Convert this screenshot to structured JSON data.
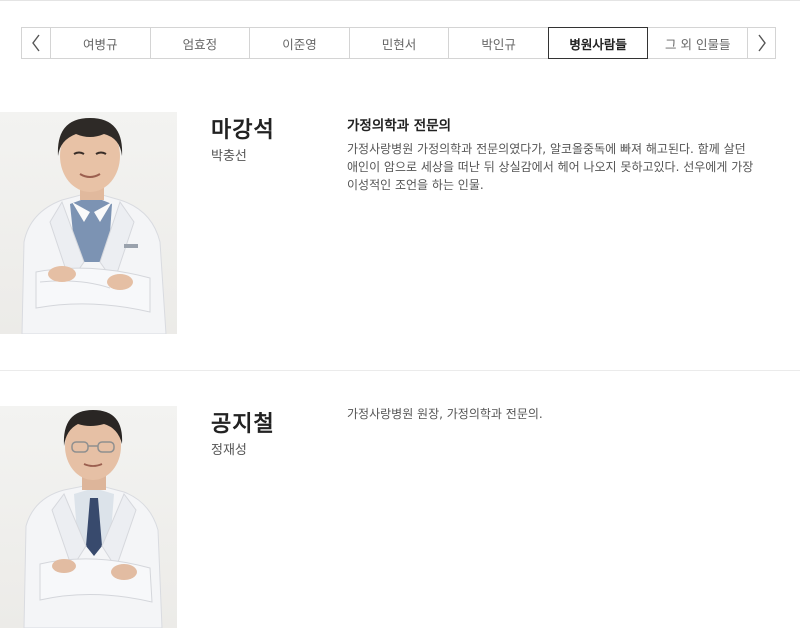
{
  "tabs": {
    "prev_icon": "chevron-left-icon",
    "next_icon": "chevron-right-icon",
    "items": [
      {
        "label": "여병규"
      },
      {
        "label": "엄효정"
      },
      {
        "label": "이준영"
      },
      {
        "label": "민현서"
      },
      {
        "label": "박인규"
      },
      {
        "label": "병원사람들"
      },
      {
        "label": "그 외 인물들"
      }
    ],
    "active_index": 5
  },
  "characters": [
    {
      "name": "마강석",
      "actor": "박충선",
      "role_title": "가정의학과 전문의",
      "description": "가정사랑병원 가정의학과 전문의였다가, 알코올중독에 빠져 해고된다. 함께 살던 애인이 암으로 세상을 떠난 뒤 상실감에서 헤어 나오지 못하고있다. 선우에게 가장 이성적인 조언을 하는 인물."
    },
    {
      "name": "공지철",
      "actor": "정재성",
      "role_title": "",
      "description": "가정사랑병원 원장, 가정의학과 전문의."
    }
  ],
  "colors": {
    "active_border": "#333333",
    "border": "#d4d4d4",
    "coat": "#f4f5f7"
  }
}
